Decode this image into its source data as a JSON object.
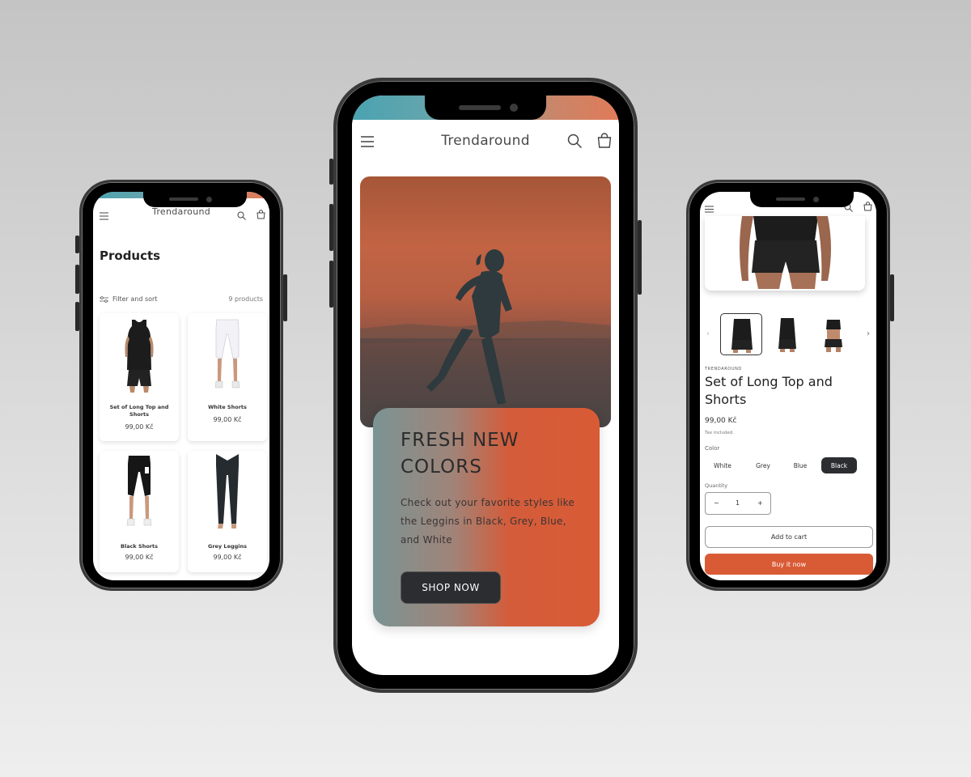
{
  "store": {
    "brand": "Trendaround"
  },
  "collection": {
    "title": "Products",
    "filter_label": "Filter and sort",
    "product_count": "9 products",
    "products": [
      {
        "name": "Set of Long Top and Shorts",
        "price": "99,00 Kč"
      },
      {
        "name": "White Shorts",
        "price": "99,00 Kč"
      },
      {
        "name": "Black Shorts",
        "price": "99,00 Kč"
      },
      {
        "name": "Grey Leggins",
        "price": "99,00 Kč"
      }
    ]
  },
  "home": {
    "hero_heading": "FRESH NEW COLORS",
    "hero_text": "Check out your favorite styles like the Leggins in Black, Grey, Blue, and White",
    "cta_label": "SHOP NOW"
  },
  "product": {
    "vendor": "TRENDAROUND",
    "title": "Set of Long Top and Shorts",
    "price": "99,00 Kč",
    "tax_note": "Tax included.",
    "color_label": "Color",
    "colors": [
      "White",
      "Grey",
      "Blue",
      "Black"
    ],
    "selected_color": "Black",
    "quantity_label": "Quantity",
    "quantity_value": "1",
    "qty_minus": "−",
    "qty_plus": "+",
    "add_to_cart_label": "Add to cart",
    "buy_now_label": "Buy it now",
    "gallery_prev": "‹",
    "gallery_next": "›"
  },
  "icons": [
    "menu-icon",
    "search-icon",
    "cart-icon",
    "filter-icon"
  ],
  "colors": {
    "accent": "#d95b36",
    "dark_button": "#2b2d30",
    "status_teal": "#4aa3b1"
  }
}
